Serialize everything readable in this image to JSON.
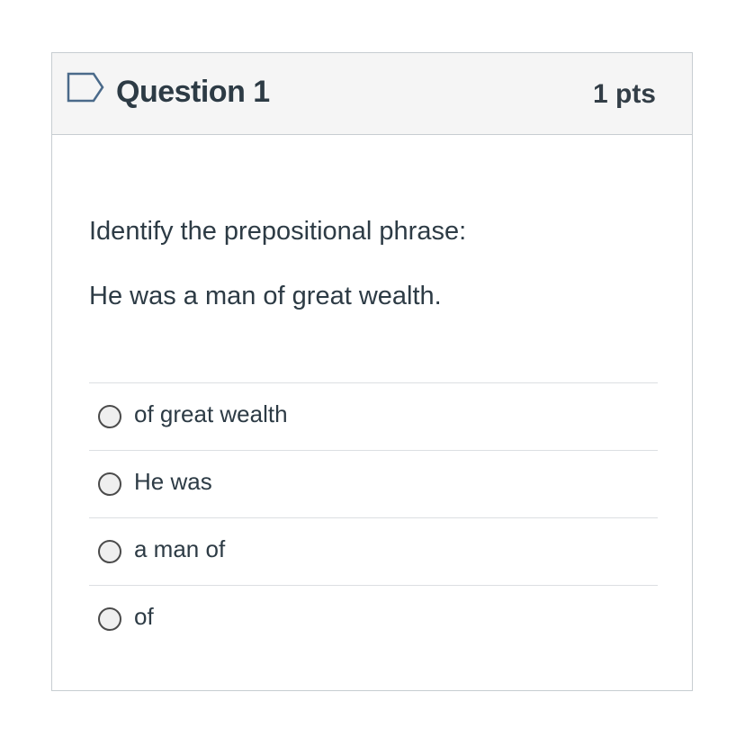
{
  "question": {
    "title": "Question 1",
    "points": "1 pts",
    "prompt": "Identify the prepositional phrase:",
    "sentence": "He was a man of great wealth."
  },
  "answers": [
    {
      "label": "of great wealth",
      "selected": false
    },
    {
      "label": "He was",
      "selected": false
    },
    {
      "label": "a man of",
      "selected": false
    },
    {
      "label": "of",
      "selected": false
    }
  ],
  "icons": {
    "flag": "flag-icon"
  },
  "colors": {
    "header_bg": "#f5f5f5",
    "border": "#c7cdd1",
    "text": "#2d3b45",
    "flag_stroke": "#4a6a8a"
  }
}
